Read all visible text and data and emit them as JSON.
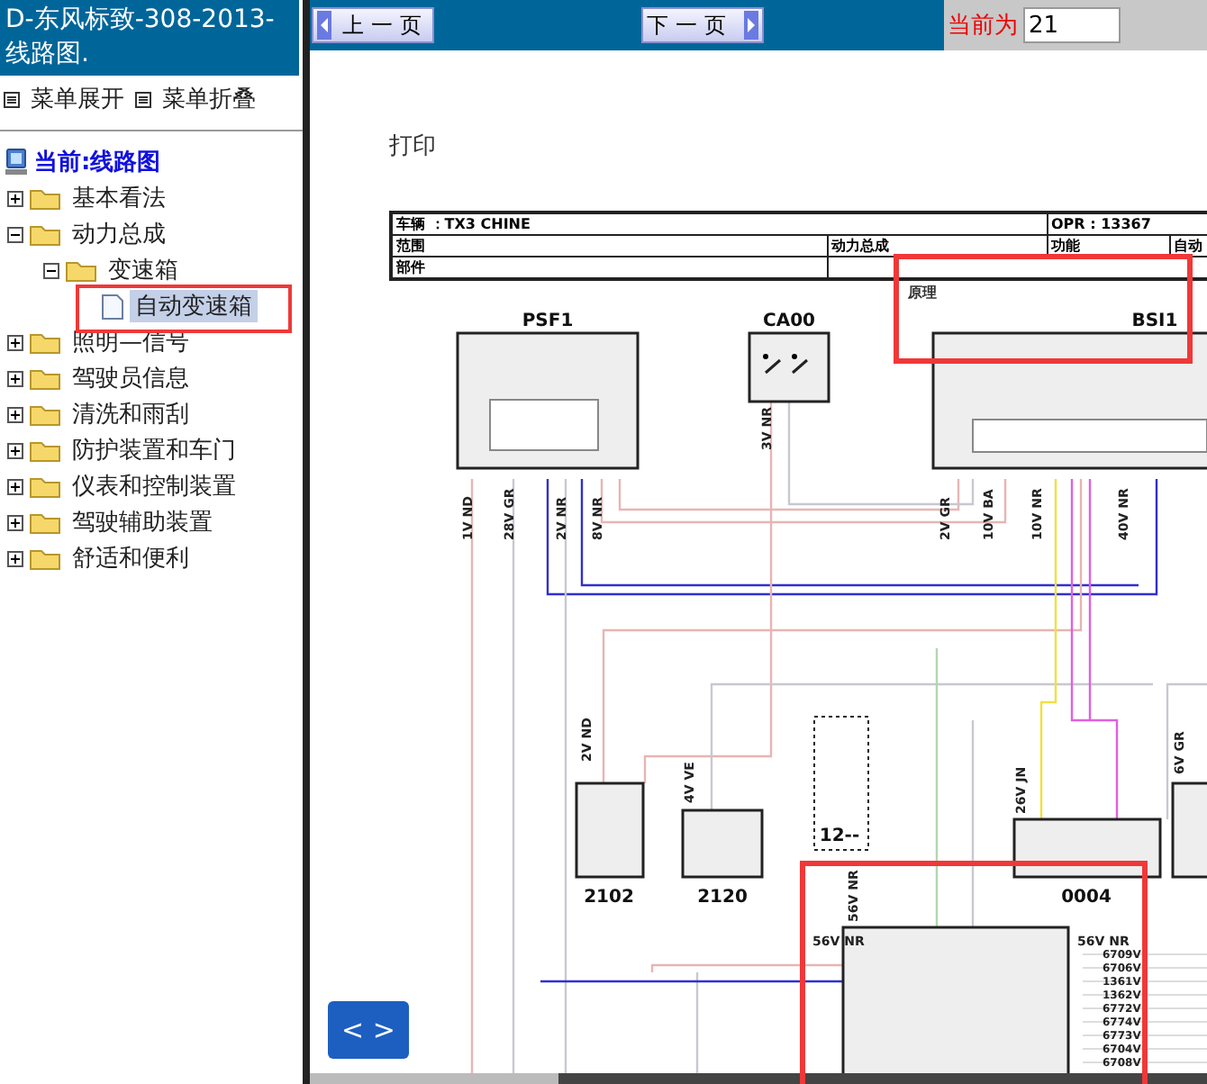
{
  "sidebar": {
    "title": "D-东风标致-308-2013- 线路图.",
    "menu_buttons": [
      {
        "label": "菜单展开"
      },
      {
        "label": "菜单折叠"
      }
    ],
    "current": "当前:线路图",
    "tree": [
      {
        "label": "基本看法",
        "kind": "folder",
        "expanded": false,
        "selected": false
      },
      {
        "label": "动力总成",
        "kind": "folder",
        "expanded": true,
        "selected": false,
        "children": [
          {
            "label": "变速箱",
            "kind": "folder",
            "expanded": true,
            "selected": false,
            "children": [
              {
                "label": "自动变速箱",
                "kind": "page",
                "selected": true
              }
            ]
          }
        ]
      },
      {
        "label": "照明—信号",
        "kind": "folder",
        "expanded": false,
        "selected": false
      },
      {
        "label": "驾驶员信息",
        "kind": "folder",
        "expanded": false,
        "selected": false
      },
      {
        "label": "清洗和雨刮",
        "kind": "folder",
        "expanded": false,
        "selected": false
      },
      {
        "label": "防护装置和车门",
        "kind": "folder",
        "expanded": false,
        "selected": false
      },
      {
        "label": "仪表和控制装置",
        "kind": "folder",
        "expanded": false,
        "selected": false
      },
      {
        "label": "驾驶辅助装置",
        "kind": "folder",
        "expanded": false,
        "selected": false
      },
      {
        "label": "舒适和便利",
        "kind": "folder",
        "expanded": false,
        "selected": false
      }
    ]
  },
  "toolbar": {
    "prev_button": "上一页",
    "next_button": "下一页",
    "page_label": "当前为",
    "page_value": "21"
  },
  "document": {
    "print_label": "打印",
    "header_table": [
      [
        "车辆 ：TX3 CHINE",
        "OPR : 13367"
      ],
      [
        "范围",
        "动力总成",
        "功能",
        "自动"
      ],
      [
        "部件"
      ]
    ],
    "section_label": "原理",
    "components": [
      "PSF1",
      "CA00",
      "BSI1",
      "2102",
      "2120",
      "12--",
      "0004"
    ],
    "wire_labels": [
      "1V ND",
      "28V GR",
      "2V NR",
      "8V NR",
      "3V NR",
      "2V GR",
      "10V BA",
      "10V NR",
      "40V NR",
      "2V ND",
      "4V VE",
      "26V JN",
      "6V GR",
      "56V NR",
      "56V NR",
      "56V NR"
    ],
    "pin_labels": [
      "6709V",
      "6706V",
      "1361V",
      "1362V",
      "6772V",
      "6774V",
      "6773V",
      "6704V",
      "6708V"
    ]
  },
  "nav_button": "< >"
}
